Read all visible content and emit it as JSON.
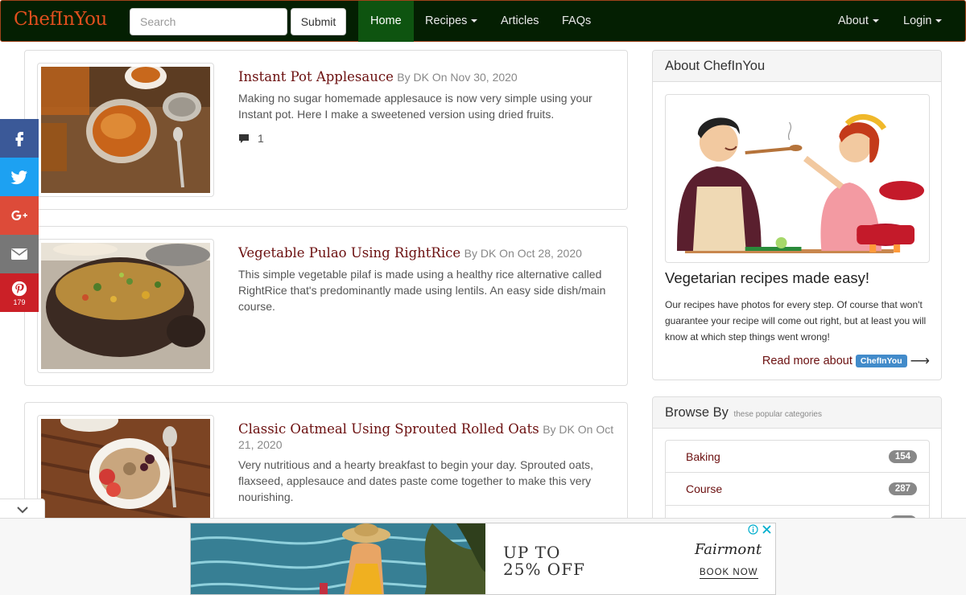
{
  "nav": {
    "brand": "ChefInYou",
    "search_placeholder": "Search",
    "submit_label": "Submit",
    "items": [
      "Home",
      "Recipes",
      "Articles",
      "FAQs"
    ],
    "about": "About",
    "login": "Login"
  },
  "posts": [
    {
      "title": "Instant Pot Applesauce",
      "meta": "By DK On Nov 30, 2020",
      "excerpt": "Making no sugar homemade applesauce is now very simple using your Instant pot. Here I make a sweetened version using dried fruits.",
      "comments": "1"
    },
    {
      "title": "Vegetable Pulao Using RightRice",
      "meta": "By DK On Oct 28, 2020",
      "excerpt": "This simple vegetable pilaf is made using a healthy rice alternative called RightRice that's predominantly made using lentils. An easy side dish/main course."
    },
    {
      "title": "Classic Oatmeal Using Sprouted Rolled Oats",
      "meta": "By DK On Oct 21, 2020",
      "excerpt": "Very nutritious and a hearty breakfast to begin your day. Sprouted oats, flaxseed, applesauce and dates paste come together to make this very nourishing."
    }
  ],
  "social": {
    "pinterest_count": "179",
    "colors": {
      "facebook": "#3b5998",
      "twitter": "#1da1f2",
      "google": "#dd4b39",
      "email": "#777777",
      "pinterest": "#cb2027"
    }
  },
  "sidebar": {
    "about": {
      "heading": "About ChefInYou",
      "tagline": "Vegetarian recipes made easy!",
      "text": "Our recipes have photos for every step. Of course that won't guarantee your recipe will come out right, but at least you will know at which step things went wrong!",
      "read_more": "Read more about",
      "brand_label": "ChefInYou"
    },
    "browse": {
      "heading": "Browse By",
      "subheading": "these popular categories",
      "categories": [
        {
          "name": "Baking",
          "count": "154"
        },
        {
          "name": "Course",
          "count": "287"
        }
      ]
    }
  },
  "ad": {
    "headline": "UP TO\n25% OFF",
    "brand": "Fairmont",
    "cta": "BOOK NOW"
  },
  "colors": {
    "nav_bg": "#041f02",
    "nav_active": "#0e5410",
    "brand": "#e04f1e",
    "link": "#6b0f0f"
  }
}
